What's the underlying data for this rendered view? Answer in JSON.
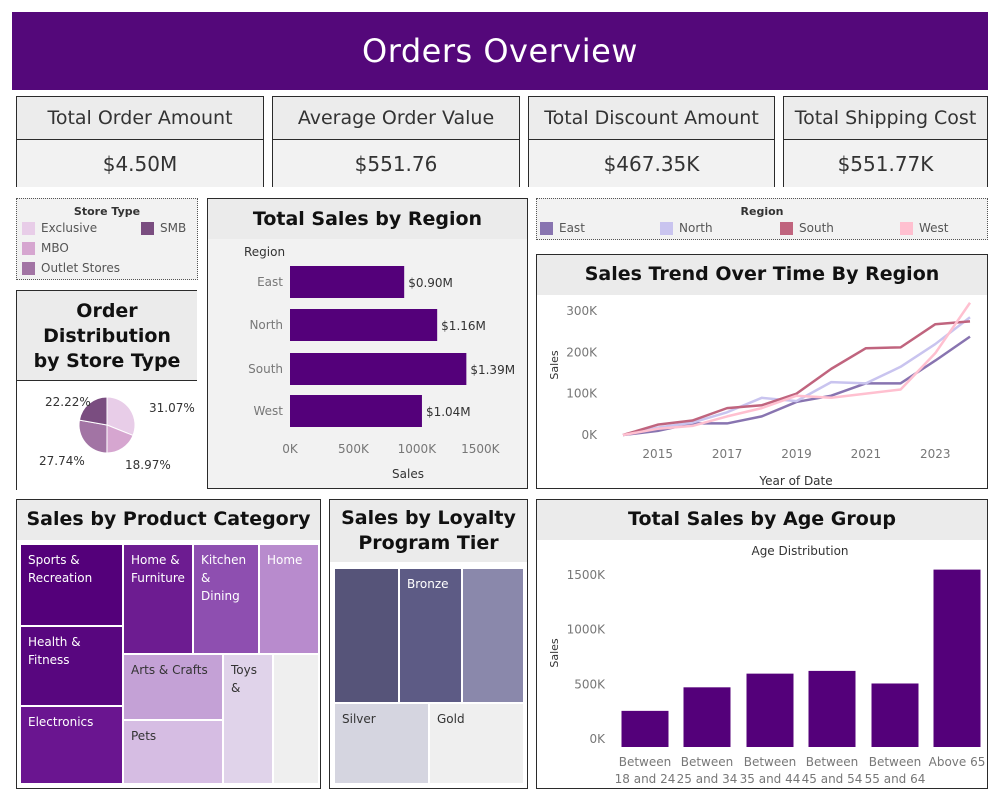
{
  "header": {
    "title": "Orders Overview"
  },
  "kpis": [
    {
      "label": "Total Order Amount",
      "value": "$4.50M"
    },
    {
      "label": "Average Order Value",
      "value": "$551.76"
    },
    {
      "label": "Total Discount Amount",
      "value": "$467.35K"
    },
    {
      "label": "Total Shipping Cost",
      "value": "$551.77K"
    }
  ],
  "store_legend": {
    "title": "Store Type",
    "items": [
      {
        "label": "Exclusive",
        "color": "#e8cde8"
      },
      {
        "label": "SMB",
        "color": "#7a4d80"
      },
      {
        "label": "MBO",
        "color": "#d6a6d0"
      },
      {
        "label": "Outlet Stores",
        "color": "#a274a4"
      }
    ]
  },
  "region_legend": {
    "title": "Region",
    "items": [
      {
        "label": "East",
        "color": "#8874b0"
      },
      {
        "label": "North",
        "color": "#c9c4ef"
      },
      {
        "label": "South",
        "color": "#c0647e"
      },
      {
        "label": "West",
        "color": "#ffc0d0"
      }
    ]
  },
  "panels": {
    "store_pie": "Order Distribution by Store Type",
    "region_bar": "Total Sales by Region",
    "trend": "Sales Trend Over Time By Region",
    "category": "Sales by Product Category",
    "loyalty": "Sales by Loyalty Program Tier",
    "age": "Total Sales by Age Group"
  },
  "pie_labels": [
    "31.07%",
    "18.97%",
    "27.74%",
    "22.22%"
  ],
  "region_bar_axis": {
    "category_title": "Region",
    "xlabel": "Sales",
    "xticks": [
      "0K",
      "500K",
      "1000K",
      "1500K"
    ]
  },
  "trend_axis": {
    "ylabel": "Sales",
    "xlabel": "Year of Date",
    "yticks": [
      "0K",
      "100K",
      "200K",
      "300K"
    ],
    "xticks": [
      "2015",
      "2017",
      "2019",
      "2021",
      "2023"
    ]
  },
  "age_axis": {
    "title": "Age Distribution",
    "ylabel": "Sales",
    "yticks": [
      "0K",
      "500K",
      "1000K",
      "1500K"
    ]
  },
  "treemap_category": [
    {
      "label": "Sports & Recreation",
      "color": "#54007a"
    },
    {
      "label": "Health & Fitness",
      "color": "#58067f"
    },
    {
      "label": "Electronics",
      "color": "#6a1590"
    },
    {
      "label": "Home & Furniture",
      "color": "#6d1c91"
    },
    {
      "label": "Kitchen & Dining",
      "color": "#8e4fb0"
    },
    {
      "label": "Home",
      "color": "#b88bcd"
    },
    {
      "label": "Arts & Crafts",
      "color": "#c4a1d6"
    },
    {
      "label": "Toys &",
      "color": "#e0d3ea"
    },
    {
      "label": "Pets",
      "color": "#d6bde3"
    },
    {
      "label": "",
      "color": "#efefef"
    }
  ],
  "treemap_loyalty": [
    {
      "label": "",
      "color": "#565479"
    },
    {
      "label": "Bronze",
      "color": "#5d5b85"
    },
    {
      "label": "",
      "color": "#8a88ab"
    },
    {
      "label": "Silver",
      "color": "#d5d5e0"
    },
    {
      "label": "Gold",
      "color": "#efefef"
    }
  ],
  "chart_data": [
    {
      "type": "pie",
      "title": "Order Distribution by Store Type",
      "categories": [
        "Exclusive",
        "MBO",
        "Outlet Stores",
        "SMB"
      ],
      "values": [
        31.07,
        18.97,
        27.74,
        22.22
      ],
      "colors": [
        "#e8cde8",
        "#d6a6d0",
        "#a274a4",
        "#7a4d80"
      ]
    },
    {
      "type": "bar",
      "orientation": "horizontal",
      "title": "Total Sales by Region",
      "categories": [
        "East",
        "North",
        "South",
        "West"
      ],
      "values": [
        0.9,
        1.16,
        1.39,
        1.04
      ],
      "labels": [
        "$0.90M",
        "$1.16M",
        "$1.39M",
        "$1.04M"
      ],
      "xlabel": "Sales",
      "xlim": [
        0,
        1.6
      ],
      "color": "#54007a"
    },
    {
      "type": "line",
      "title": "Sales Trend Over Time By Region",
      "x": [
        2014,
        2015,
        2016,
        2017,
        2018,
        2019,
        2020,
        2021,
        2022,
        2023,
        2024
      ],
      "series": [
        {
          "name": "East",
          "color": "#8874b0",
          "values": [
            0,
            10,
            28,
            28,
            45,
            80,
            95,
            125,
            125,
            180,
            238
          ]
        },
        {
          "name": "North",
          "color": "#c9c4ef",
          "values": [
            0,
            18,
            30,
            55,
            90,
            82,
            128,
            125,
            165,
            220,
            285
          ]
        },
        {
          "name": "South",
          "color": "#c0647e",
          "values": [
            0,
            25,
            35,
            65,
            72,
            100,
            160,
            210,
            212,
            268,
            275
          ]
        },
        {
          "name": "West",
          "color": "#ffc0d0",
          "values": [
            0,
            15,
            22,
            45,
            65,
            95,
            90,
            100,
            110,
            198,
            320
          ]
        }
      ],
      "xlabel": "Year of Date",
      "ylabel": "Sales",
      "ylim": [
        -10,
        330
      ]
    },
    {
      "type": "bar",
      "title": "Total Sales by Age Group",
      "subtitle": "Age Distribution",
      "categories": [
        "Between 18 and 24",
        "Between 25 and 34",
        "Between 35 and 44",
        "Between 45 and 54",
        "Between 55 and 64",
        "Above 65"
      ],
      "values": [
        330,
        545,
        670,
        695,
        580,
        1620
      ],
      "ylabel": "Sales",
      "ylim": [
        -100,
        1760
      ],
      "color": "#54007a"
    }
  ]
}
